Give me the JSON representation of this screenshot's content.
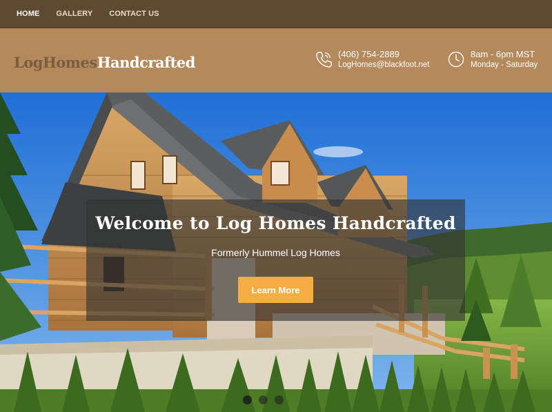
{
  "nav": {
    "items": [
      {
        "label": "HOME",
        "active": true
      },
      {
        "label": "GALLERY",
        "active": false
      },
      {
        "label": "CONTACT US",
        "active": false
      }
    ]
  },
  "brand": {
    "logo_part1": "LogHomes",
    "logo_part2": "Handcrafted",
    "logo_color1": "#7a5d3f",
    "logo_color2": "#ffffff"
  },
  "contact": {
    "phone": "(406) 754-2889",
    "email": "LogHomes@blackfoot.net",
    "phone_icon": "phone-icon",
    "hours": "8am - 6pm MST",
    "days": "Monday - Saturday",
    "hours_icon": "clock-icon"
  },
  "hero": {
    "title": "Welcome to Log Homes Handcrafted",
    "subtitle": "Formerly Hummel Log Homes",
    "button_label": "Learn More",
    "slides": 3,
    "active_slide": 0
  },
  "colors": {
    "nav_bg": "#5e4a33",
    "brand_bg": "#b48a5d",
    "accent": "#f6ad43"
  }
}
